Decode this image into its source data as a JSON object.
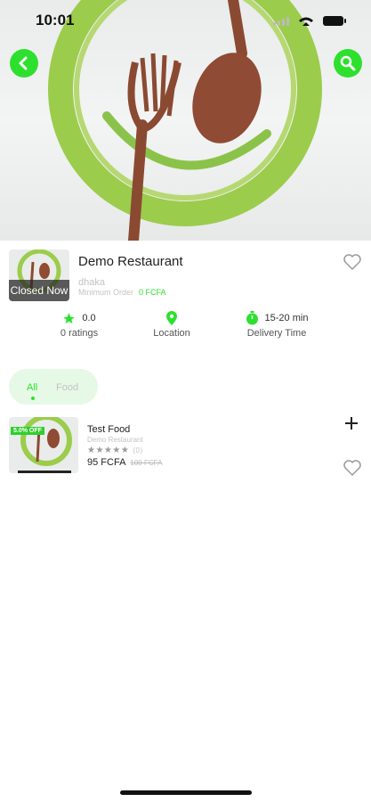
{
  "status_bar": {
    "time": "10:01"
  },
  "hero": {
    "icons": [
      "back-icon",
      "search-icon"
    ],
    "accent": "#2ee02e"
  },
  "restaurant": {
    "name": "Demo Restaurant",
    "location": "dhaka",
    "closed_label": "Closed Now",
    "min_order_label": "Minimum Order",
    "min_order_value": "0 FCFA"
  },
  "stats": {
    "rating_value": "0.0",
    "rating_label": "0 ratings",
    "location_label": "Location",
    "delivery_time": "15-20 min",
    "delivery_label": "Delivery Time"
  },
  "tabs": [
    {
      "label": "All",
      "active": true
    },
    {
      "label": "Food",
      "active": false
    }
  ],
  "items": [
    {
      "name": "Test Food",
      "restaurant": "Demo Restaurant",
      "stars": "★★★★★",
      "rating_count": "(0)",
      "price": "95 FCFA",
      "old_price": "100 FCFA",
      "discount_badge": "5.0% OFF"
    }
  ],
  "colors": {
    "green": "#2ee02e",
    "muted": "#c3c3c3"
  }
}
